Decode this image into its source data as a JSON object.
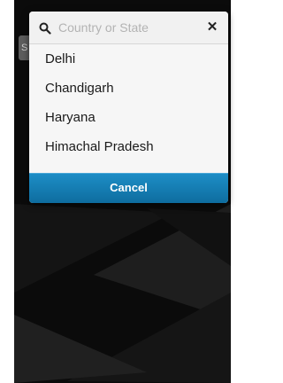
{
  "background": {
    "tab_fragment": "S"
  },
  "dialog": {
    "search": {
      "icon": "search-icon",
      "placeholder": "Country or State",
      "value": "",
      "clear_symbol": "✕"
    },
    "items": [
      {
        "label": "Delhi"
      },
      {
        "label": "Chandigarh"
      },
      {
        "label": "Haryana"
      },
      {
        "label": "Himachal Pradesh"
      }
    ],
    "cancel_label": "Cancel"
  },
  "colors": {
    "accent": "#1a85bd",
    "overlay": "#0c0c0c"
  }
}
